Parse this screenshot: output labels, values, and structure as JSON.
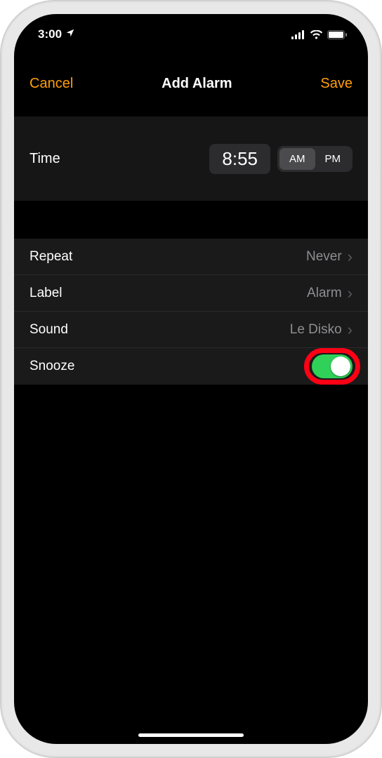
{
  "status": {
    "time": "3:00",
    "location_icon": "➤"
  },
  "nav": {
    "cancel": "Cancel",
    "title": "Add Alarm",
    "save": "Save"
  },
  "time": {
    "label": "Time",
    "value": "8:55",
    "am": "AM",
    "pm": "PM",
    "period": "AM"
  },
  "rows": {
    "repeat": {
      "label": "Repeat",
      "value": "Never"
    },
    "label": {
      "label": "Label",
      "value": "Alarm"
    },
    "sound": {
      "label": "Sound",
      "value": "Le Disko"
    },
    "snooze": {
      "label": "Snooze",
      "on": true
    }
  }
}
